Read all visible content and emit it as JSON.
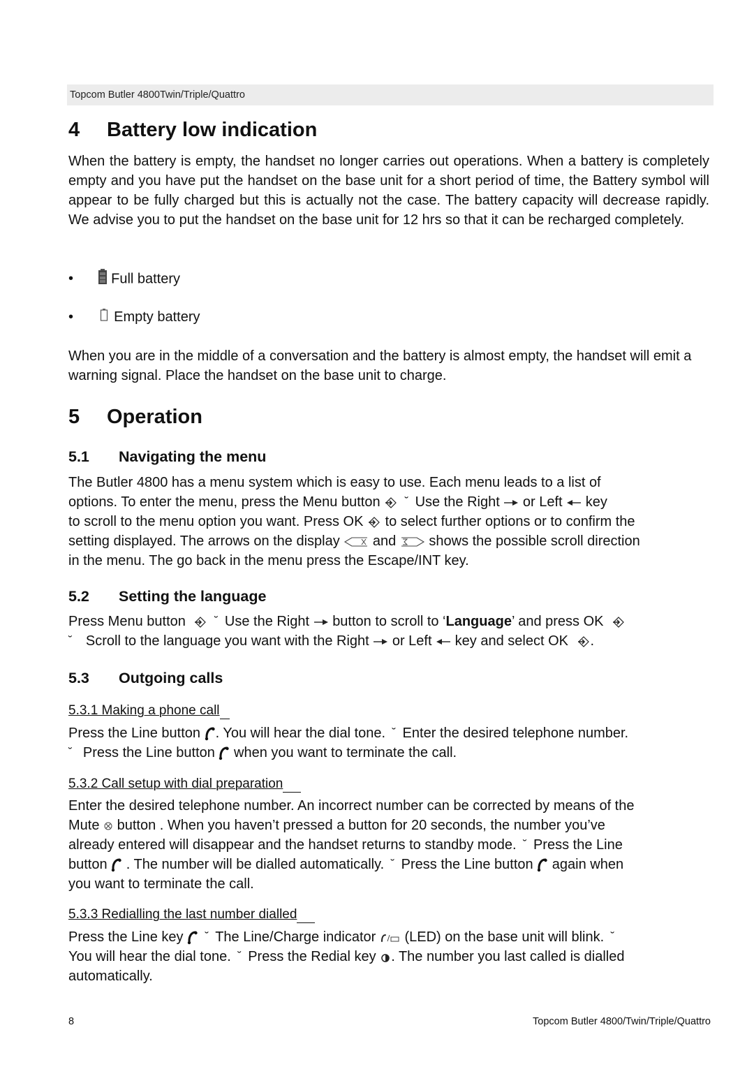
{
  "header": {
    "running_title": "Topcom Butler 4800Twin/Triple/Quattro"
  },
  "section4": {
    "number": "4",
    "title": "Battery low indication",
    "intro": "When the battery is empty, the handset no longer carries out operations. When a battery is completely empty and you have put the handset on the base unit for a short period of time, the Battery symbol will appear to be fully charged but this is actually not the case. The battery capacity will decrease rapidly. We advise you to put the handset on the base unit for 12 hrs so that it can be recharged completely.",
    "bullets": [
      {
        "bullet": "•",
        "icon": "battery-full-icon",
        "label": "Full battery"
      },
      {
        "bullet": "•",
        "icon": "battery-empty-icon",
        "label": "Empty battery"
      }
    ],
    "warning": "When you are in the middle of a conversation and the battery is almost empty, the handset will emit a warning signal. Place the handset on the base unit to charge."
  },
  "section5": {
    "number": "5",
    "title": "Operation",
    "s51": {
      "number": "5.1",
      "title": "Navigating the menu",
      "l1": "The Butler 4800 has a menu system which is easy to use.  Each menu leads to a list of",
      "l2a": "options.  To enter the menu, press the Menu button",
      "l2b": "Use the Right",
      "l2c": "or Left",
      "l2d": "key",
      "l3a": "to scroll to the menu option you want.  Press OK",
      "l3b": "to select further options or to confirm the",
      "l4a": "setting displayed. The arrows on the display",
      "l4b": "and",
      "l4c": "shows the possible scroll direction",
      "l5": "in the menu. The go back in the menu press the Escape/INT key."
    },
    "s52": {
      "number": "5.2",
      "title": "Setting the language",
      "l1a": "Press Menu button",
      "l1b": "Use the Right",
      "l1c": "button to scroll to ‘",
      "l1kw": "Language",
      "l1d": "’ and press OK",
      "l2a": "Scroll to the language you want with the Right",
      "l2b": "or Left",
      "l2c": "key and select OK",
      "l2d": "."
    },
    "s53": {
      "number": "5.3",
      "title": "Outgoing calls",
      "s531": {
        "title": "5.3.1 Making a phone call",
        "l1a": "Press the Line button",
        "l1b": ". You will hear the dial tone.",
        "l1c": "Enter the desired telephone number.",
        "l2a": "Press the Line button",
        "l2b": "when you want to terminate the call."
      },
      "s532": {
        "title": "5.3.2 Call setup with dial preparation",
        "l1": "Enter the desired telephone number. An incorrect number can be corrected by means of the",
        "l2a": "Mute",
        "l2b": "button . When you haven’t pressed a button for 20 seconds, the number you’ve",
        "l3a": "already entered will disappear and the handset returns to standby mode.",
        "l3b": "Press the Line",
        "l4a": "button",
        "l4b": ". The number will be dialled automatically.",
        "l4c": "Press the Line button",
        "l4d": "again when",
        "l5": "you want to terminate the call."
      },
      "s533": {
        "title": "5.3.3 Redialling the last number dialled",
        "l1a": "Press the Line key",
        "l1b": "The Line/Charge indicator",
        "l1c": "(LED) on the base unit will blink.",
        "l2a": "You will hear the dial tone.",
        "l2b": "Press the Redial key",
        "l2c": ". The number you last called is dialled",
        "l3": "automatically."
      }
    }
  },
  "symbols": {
    "step": "˘"
  },
  "footer": {
    "page_number": "8",
    "title": "Topcom Butler 4800/Twin/Triple/Quattro"
  }
}
